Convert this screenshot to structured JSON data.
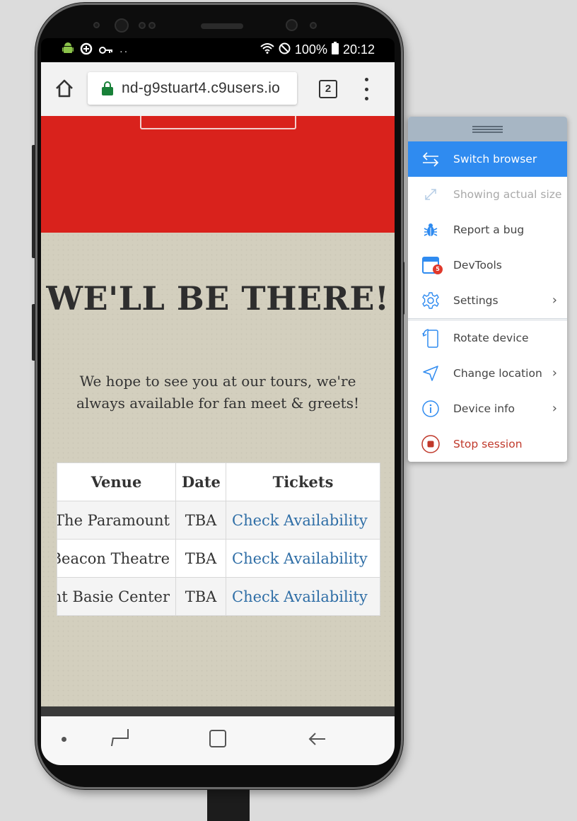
{
  "status_bar": {
    "battery": "100%",
    "time": "20:12"
  },
  "browser": {
    "url": "nd-g9stuart4.c9users.io",
    "tab_count": "2"
  },
  "page": {
    "headline": "WE'LL BE THERE!",
    "subtext": "We hope to see you at our tours, we're always available for fan meet & greets!",
    "table": {
      "headers": [
        "Venue",
        "Date",
        "Tickets"
      ],
      "rows": [
        {
          "venue": "The Paramount",
          "date": "TBA",
          "tickets": "Check Availability"
        },
        {
          "venue": "Beacon Theatre",
          "date": "TBA",
          "tickets": "Check Availability"
        },
        {
          "venue": "Count Basie Center",
          "date": "TBA",
          "tickets": "Check Availability"
        }
      ]
    }
  },
  "side_menu": {
    "items": [
      {
        "label": "Switch browser",
        "icon": "switch-arrows-icon",
        "state": "active"
      },
      {
        "label": "Showing actual size",
        "icon": "resize-icon",
        "state": "disabled"
      },
      {
        "label": "Report a bug",
        "icon": "bug-icon",
        "state": "normal"
      },
      {
        "label": "DevTools",
        "icon": "devtools-icon",
        "state": "normal",
        "badge": "5"
      },
      {
        "label": "Settings",
        "icon": "gear-icon",
        "state": "normal",
        "has_submenu": true
      },
      {
        "label": "Rotate device",
        "icon": "rotate-device-icon",
        "state": "normal"
      },
      {
        "label": "Change location",
        "icon": "location-arrow-icon",
        "state": "normal",
        "has_submenu": true
      },
      {
        "label": "Device info",
        "icon": "info-icon",
        "state": "normal",
        "has_submenu": true
      },
      {
        "label": "Stop session",
        "icon": "stop-icon",
        "state": "danger"
      }
    ],
    "submenu_chevron": "›"
  },
  "colors": {
    "accent": "#2f8bf0",
    "header_red": "#d9221c",
    "link_blue": "#2f6ea6",
    "danger": "#c0392b",
    "secure_green": "#188038"
  }
}
